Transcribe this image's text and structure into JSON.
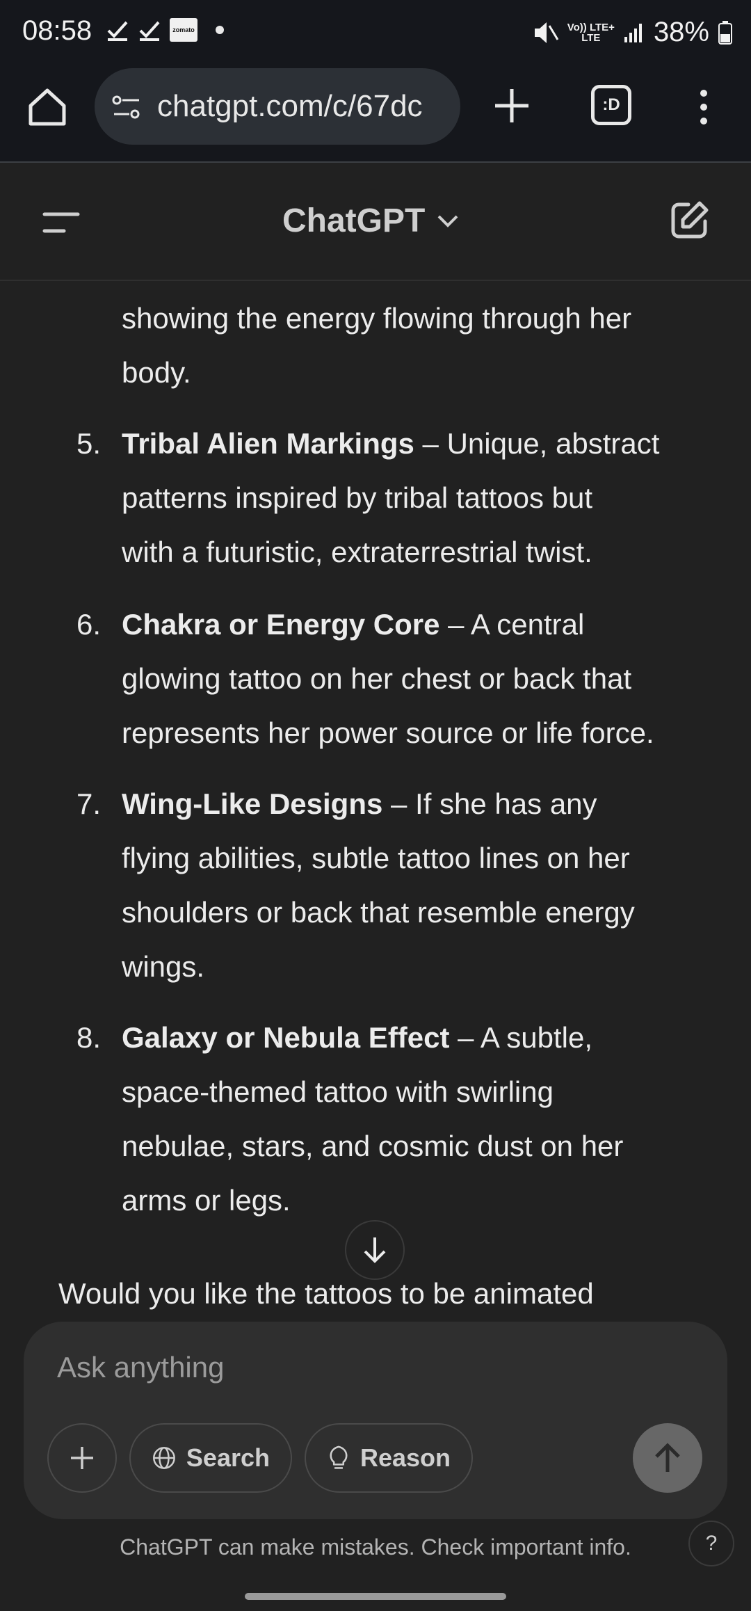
{
  "status_bar": {
    "time": "08:58",
    "zomato_label": "zomato",
    "network_top": "Vo)) LTE+",
    "network_bottom": "LTE",
    "battery": "38%"
  },
  "browser": {
    "url": "chatgpt.com/c/67dc",
    "tabs_label": ":D"
  },
  "header": {
    "title": "ChatGPT"
  },
  "message": {
    "partial_line_1": "showing the energy flowing through her",
    "partial_line_2": "body.",
    "items": [
      {
        "num": "5.",
        "title": "Tribal Alien Markings",
        "line1": " – Unique, abstract",
        "line2": "patterns inspired by tribal tattoos but",
        "line3": "with a futuristic, extraterrestrial twist."
      },
      {
        "num": "6.",
        "title": "Chakra or Energy Core",
        "line1": " – A central",
        "line2": "glowing tattoo on her chest or back that",
        "line3": "represents her power source or life force."
      },
      {
        "num": "7.",
        "title": "Wing-Like Designs",
        "line1": " – If she has any",
        "line2": "flying abilities, subtle tattoo lines on her",
        "line3": "shoulders or back that resemble energy",
        "line4": "wings."
      },
      {
        "num": "8.",
        "title": "Galaxy or Nebula Effect",
        "line1": " – A subtle,",
        "line2": "space-themed tattoo with swirling",
        "line3": "nebulae, stars, and cosmic dust on her",
        "line4": "arms or legs."
      }
    ],
    "closing": "Would you like the tattoos to be animated"
  },
  "composer": {
    "placeholder": "Ask anything",
    "search_label": "Search",
    "reason_label": "Reason"
  },
  "footer": {
    "disclaimer": "ChatGPT can make mistakes. Check important info.",
    "help": "?"
  }
}
